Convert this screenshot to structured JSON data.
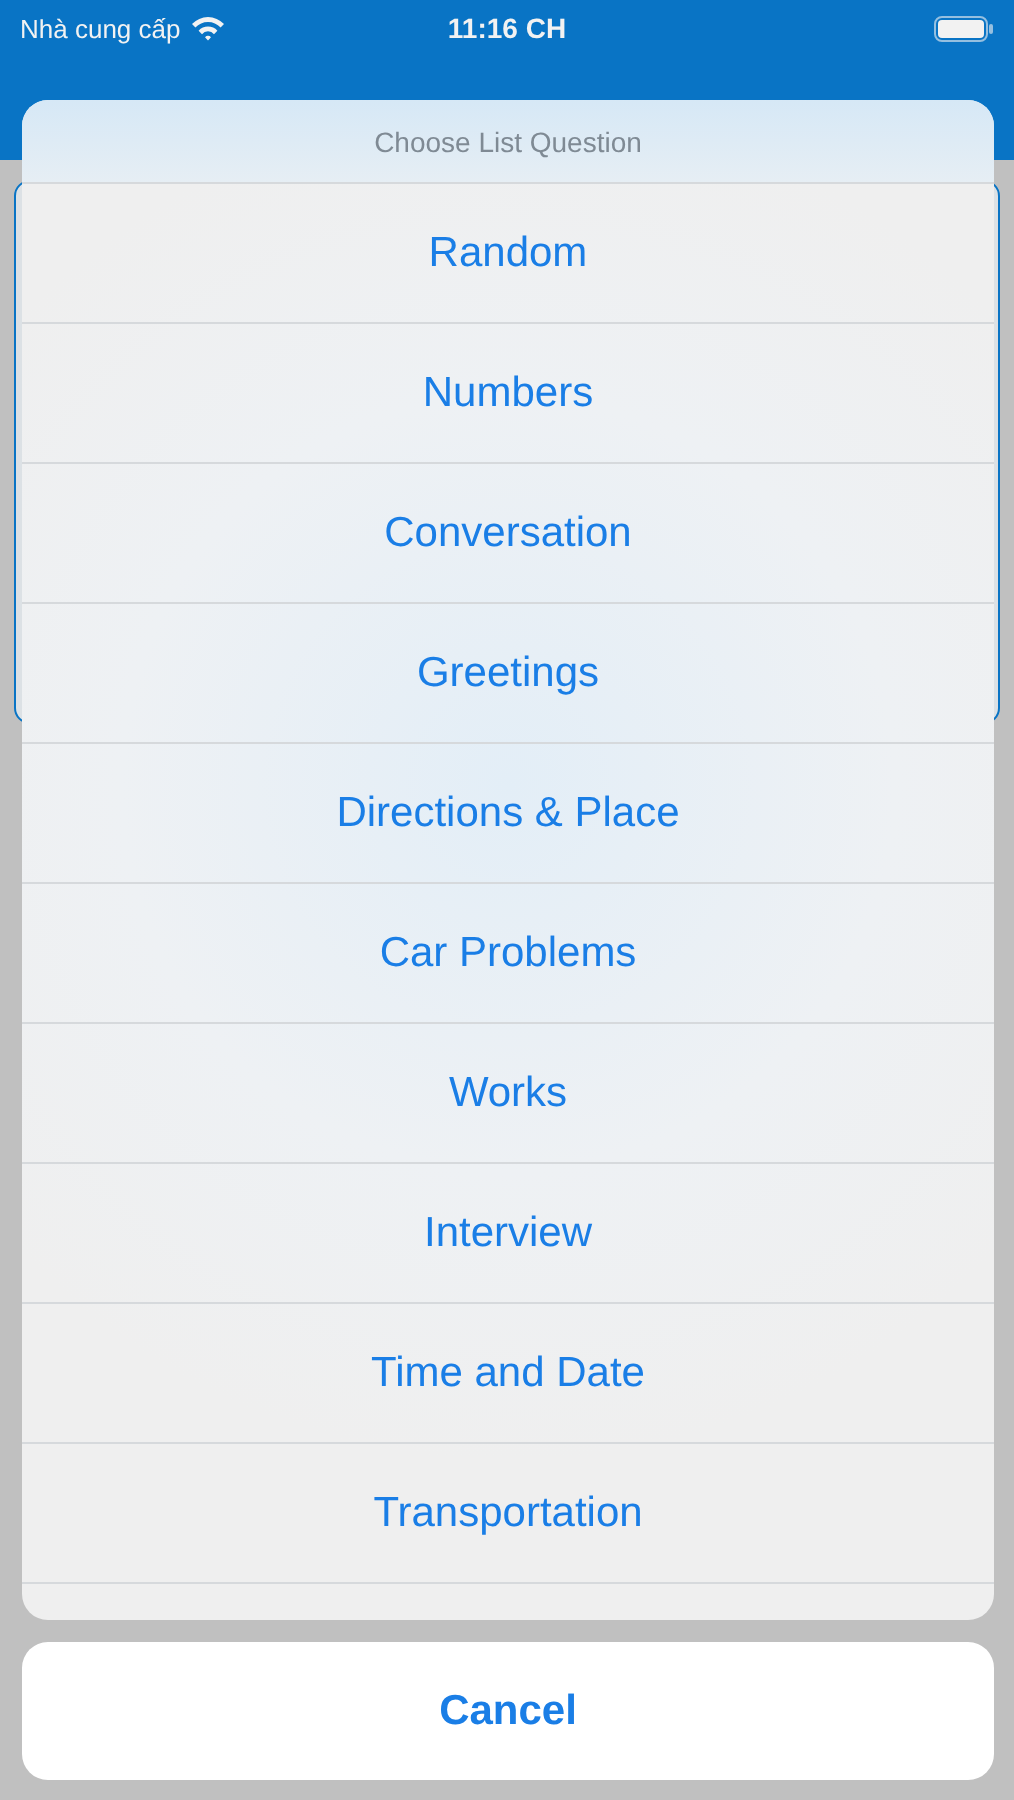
{
  "status_bar": {
    "carrier": "Nhà cung cấp",
    "time": "11:16 CH"
  },
  "action_sheet": {
    "title": "Choose List Question",
    "options": [
      {
        "label": "Random"
      },
      {
        "label": "Numbers"
      },
      {
        "label": "Conversation"
      },
      {
        "label": "Greetings"
      },
      {
        "label": "Directions & Place"
      },
      {
        "label": "Car Problems"
      },
      {
        "label": "Works"
      },
      {
        "label": "Interview"
      },
      {
        "label": "Time and Date"
      },
      {
        "label": "Transportation"
      }
    ],
    "cancel": "Cancel"
  }
}
